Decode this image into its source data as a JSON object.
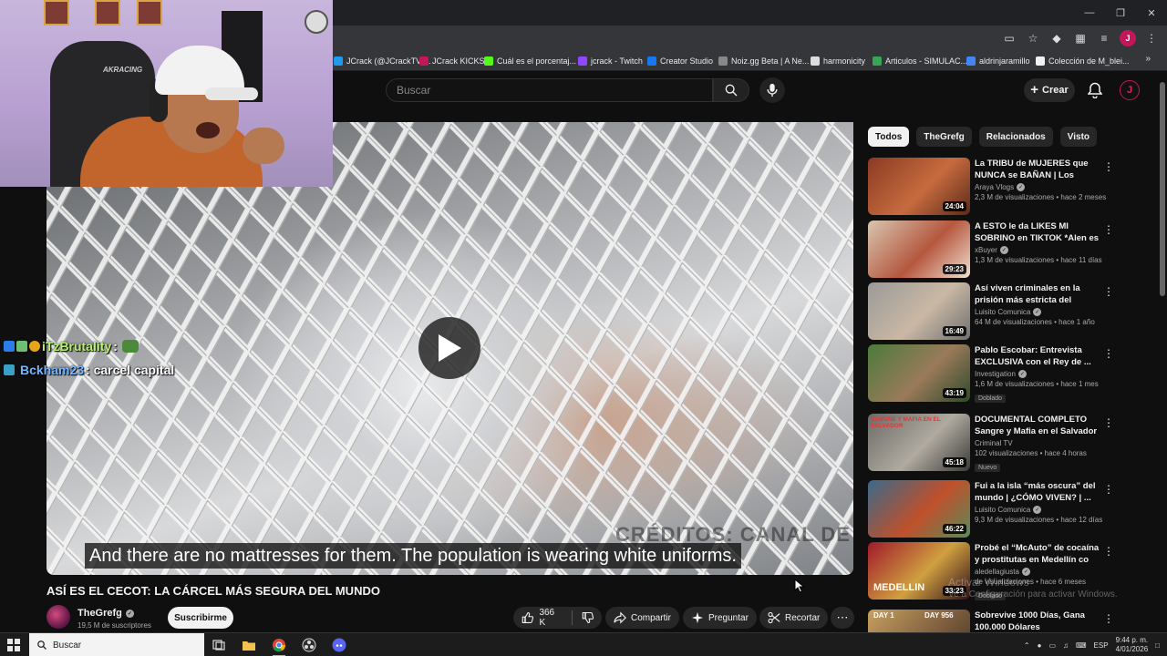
{
  "bookmarks": [
    {
      "label": "JCrack (@JCrackTV)...",
      "color": "#1d9bf0"
    },
    {
      "label": "JCrack KICKS",
      "color": "#c2185b"
    },
    {
      "label": "Cuál es el porcentaj...",
      "color": "#53fc18"
    },
    {
      "label": "jcrack - Twitch",
      "color": "#9146ff"
    },
    {
      "label": "Creator Studio",
      "color": "#1877f2"
    },
    {
      "label": "Noiz.gg Beta | A Ne...",
      "color": "#888888"
    },
    {
      "label": "harmonicity",
      "color": "#dddddd"
    },
    {
      "label": "Articulos - SIMULAC...",
      "color": "#34a853"
    },
    {
      "label": "aldrinjaramillo",
      "color": "#4285f4"
    },
    {
      "label": "Colección de M_blei...",
      "color": "#f1f1f1"
    }
  ],
  "header": {
    "search_placeholder": "Buscar",
    "create_label": "Crear"
  },
  "webcam": {
    "chair_brand": "AKRACING"
  },
  "chat": [
    {
      "user": "iTzBrutality",
      "message": ":",
      "user_color": "#b6f36a"
    },
    {
      "user": "Bckham23",
      "message": ": carcel capital",
      "user_color": "#74b6ff"
    }
  ],
  "video": {
    "watermark": "CRÉDITOS: CANAL DE NICK SHIRLEY",
    "caption": "And there are no mattresses for them. The population is wearing white uniforms.",
    "title": "ASÍ ES EL CECOT: LA CÁRCEL MÁS SEGURA DEL MUNDO",
    "channel": "TheGrefg",
    "subscribers": "19,5 M de suscriptores",
    "subscribe_label": "Suscribirme",
    "likes": "366 K",
    "share_label": "Compartir",
    "ask_label": "Preguntar",
    "clip_label": "Recortar"
  },
  "chips": [
    "Todos",
    "TheGrefg",
    "Relacionados",
    "Visto"
  ],
  "recommendations": [
    {
      "title": "La TRIBU de MUJERES que NUNCA se BAÑAN | Los Himba",
      "channel": "Araya Vlogs",
      "verified": true,
      "stats": "2,3 M de visualizaciones • hace 2 meses",
      "duration": "24:04",
      "badge": "",
      "thumb": [
        "#8a3a22",
        "#c76b3f",
        "#5a2a1a"
      ]
    },
    {
      "title": "A ESTO le da LIKES MI SOBRINO en TIKTOK *Alen es ...",
      "channel": "xBuyer",
      "verified": true,
      "stats": "1,3 M de visualizaciones • hace 11 días",
      "duration": "29:23",
      "badge": "",
      "thumb": [
        "#d8c6b0",
        "#b5573e",
        "#f0e0d0"
      ]
    },
    {
      "title": "Así viven criminales en la prisión más estricta del mundo...",
      "channel": "Luisito Comunica",
      "verified": true,
      "stats": "64 M de visualizaciones • hace 1 año",
      "duration": "16:49",
      "badge": "",
      "thumb": [
        "#9a9a98",
        "#c9b8a4",
        "#707070"
      ]
    },
    {
      "title": "Pablo Escobar: Entrevista EXCLUSIVA con el Rey de ...",
      "channel": "Investigation",
      "verified": true,
      "stats": "1,6 M de visualizaciones • hace 1 mes",
      "duration": "43:19",
      "badge": "Doblado",
      "thumb": [
        "#4c7a3c",
        "#9a7a5a",
        "#2e4a2a"
      ]
    },
    {
      "title": "DOCUMENTAL COMPLETO Sangre y Mafia en el Salvador ...",
      "channel": "Criminal TV",
      "verified": false,
      "stats": "102 visualizaciones • hace 4 horas",
      "duration": "45:18",
      "badge": "Nuevo",
      "thumb": [
        "#6a6a66",
        "#b0aaa0",
        "#3a3a38"
      ]
    },
    {
      "title": "Fui a la isla “más oscura” del mundo | ¿CÓMO VIVEN? | ...",
      "channel": "Luisito Comunica",
      "verified": true,
      "stats": "9,3 M de visualizaciones • hace 12 días",
      "duration": "46:22",
      "badge": "",
      "thumb": [
        "#3a6a8a",
        "#c0502a",
        "#5a8a5a"
      ]
    },
    {
      "title": "Probé el “McAuto” de cocaína y prostitutas en Medellín co",
      "channel": "aledellagiusta",
      "verified": true,
      "stats": "de visualizaciones • hace 6 meses",
      "duration": "33:23",
      "badge": "Doblado",
      "thumb": [
        "#a01a2a",
        "#d0a040",
        "#301018"
      ]
    },
    {
      "title": "Sobrevive 1000 Días, Gana 100.000 Dólares",
      "channel": "",
      "verified": false,
      "stats": "",
      "duration": "",
      "badge": "",
      "thumb": [
        "#c8a060",
        "#806040",
        "#403020"
      ]
    }
  ],
  "thumb_texts": {
    "salvador": "SANGRE Y MAFIA EN EL SALVADOR",
    "medellin": "MEDELLIN",
    "day1": "DAY 1",
    "day956": "DAY 956"
  },
  "activation_text": [
    "Activar Windows",
    "Ve a Configuración para activar Windows."
  ],
  "taskbar": {
    "search_label": "Buscar",
    "language": "ESP",
    "time": "9:44 p. m.",
    "date": "4/01/2026"
  }
}
